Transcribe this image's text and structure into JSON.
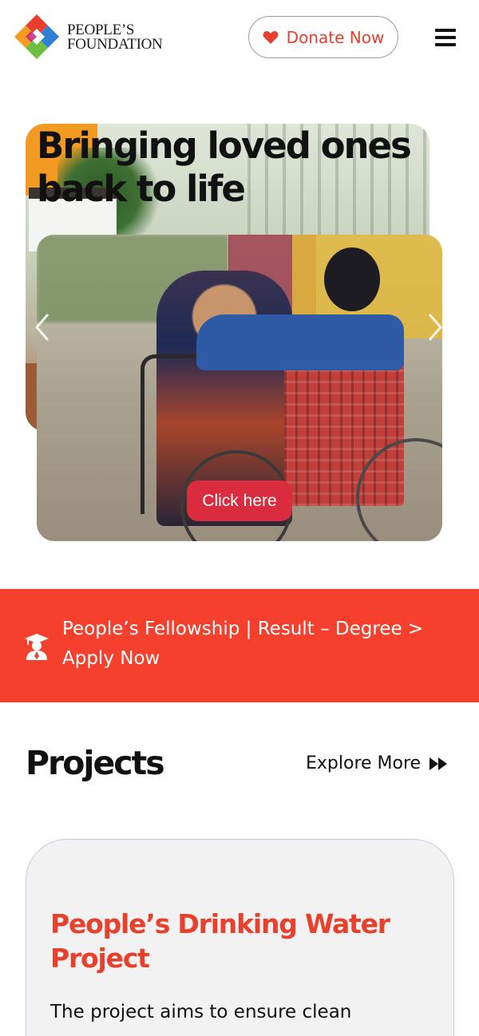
{
  "header": {
    "logo_line1": "PEOPLE’S",
    "logo_line2": "FOUNDATION",
    "donate_label": "Donate Now",
    "menu_icon": "hamburger-icon"
  },
  "hero": {
    "title": "Bringing loved ones back to life",
    "cta_label": "Click here",
    "prev_icon": "chevron-left-icon",
    "next_icon": "chevron-right-icon"
  },
  "banner": {
    "icon": "graduate-icon",
    "text": "People’s Fellowship | Result – Degree > Apply Now"
  },
  "projects": {
    "title": "Projects",
    "explore_label": "Explore More",
    "cards": [
      {
        "title": "People’s Drinking Water Project",
        "description": "The project aims to ensure clean"
      }
    ]
  },
  "colors": {
    "accent_red": "#e8402c",
    "banner_red": "#f4402d",
    "button_red": "#d92c3f"
  }
}
